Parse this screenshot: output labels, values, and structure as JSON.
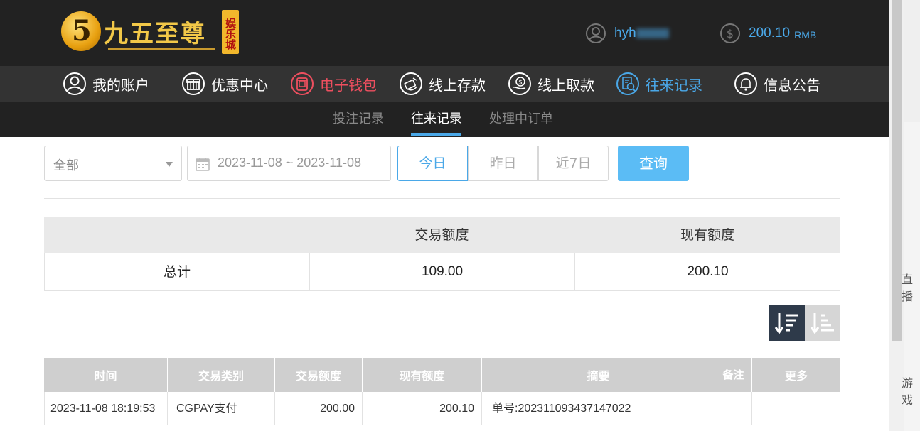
{
  "header": {
    "logo_text": "九五至尊",
    "logo_badge": "娱乐城",
    "username": "hyh",
    "balance": "200.10",
    "currency": "RMB"
  },
  "nav": [
    {
      "label": "我的账户",
      "icon": "user-circle-icon"
    },
    {
      "label": "优惠中心",
      "icon": "gift-icon"
    },
    {
      "label": "电子钱包",
      "icon": "wallet-icon"
    },
    {
      "label": "线上存款",
      "icon": "deposit-icon"
    },
    {
      "label": "线上取款",
      "icon": "withdraw-icon"
    },
    {
      "label": "往来记录",
      "icon": "records-icon"
    },
    {
      "label": "信息公告",
      "icon": "bell-icon"
    }
  ],
  "subnav": [
    {
      "label": "投注记录"
    },
    {
      "label": "往来记录"
    },
    {
      "label": "处理中订单"
    }
  ],
  "filters": {
    "type_selected": "全部",
    "date_range": "2023-11-08 ~ 2023-11-08",
    "today": "今日",
    "yesterday": "昨日",
    "last7": "近7日",
    "search": "查询"
  },
  "summary": {
    "headers": [
      "",
      "交易额度",
      "现有额度"
    ],
    "row": {
      "label": "总计",
      "amount": "109.00",
      "balance": "200.10"
    }
  },
  "table": {
    "headers": [
      "时间",
      "交易类别",
      "交易额度",
      "现有额度",
      "摘要",
      "备注",
      "更多"
    ],
    "rows": [
      [
        "2023-11-08 18:19:53",
        "CGPAY支付",
        "200.00",
        "200.10",
        "单号:202311093437147022",
        "",
        ""
      ]
    ]
  },
  "side": {
    "text1": "直播",
    "text2": "游戏"
  },
  "colors": {
    "accent": "#4aa8e8",
    "wallet": "#ee4f5f",
    "header_bg": "#222222",
    "nav_bg": "#333333"
  }
}
